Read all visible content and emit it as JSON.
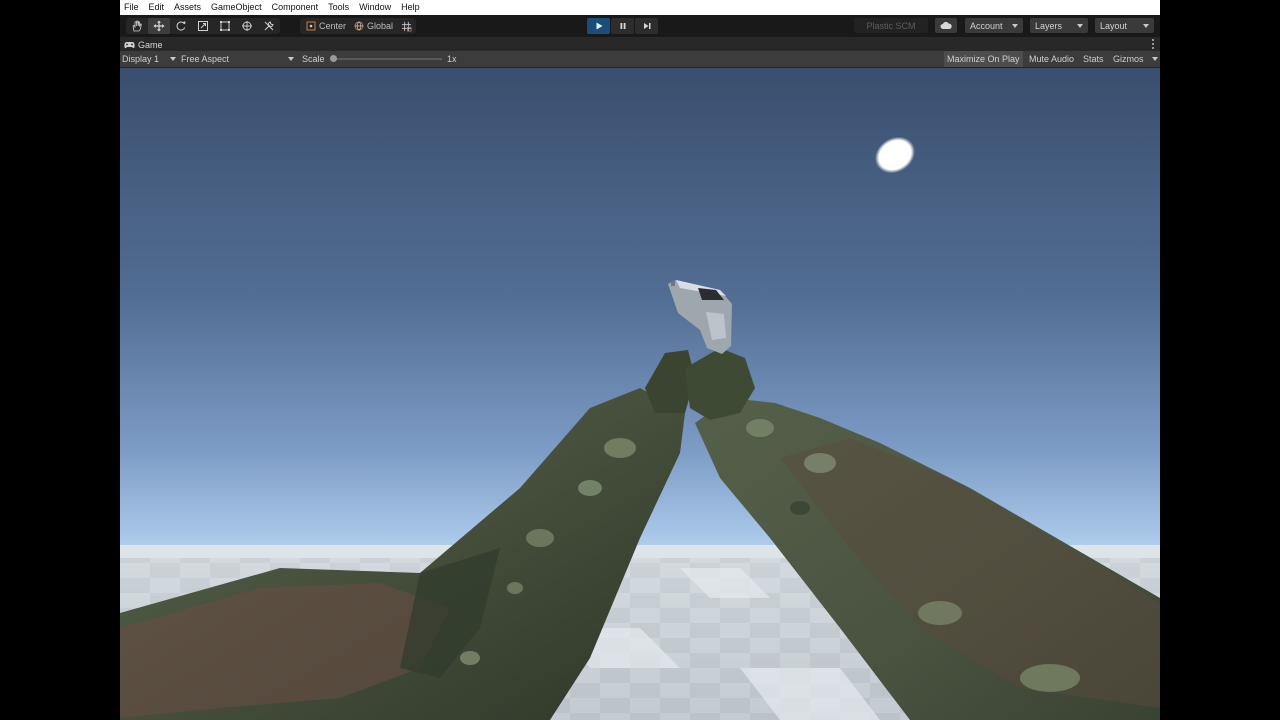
{
  "menu": [
    "File",
    "Edit",
    "Assets",
    "GameObject",
    "Component",
    "Tools",
    "Window",
    "Help"
  ],
  "toolbar": {
    "tools": [
      "hand-tool",
      "move-tool",
      "rotate-tool",
      "scale-tool",
      "rect-tool",
      "transform-tool",
      "custom-tool"
    ],
    "active_tool": "move-tool",
    "pivot_label": "Center",
    "space_label": "Global",
    "play_state": "playing",
    "plastic_label": "Plastic SCM",
    "account_label": "Account",
    "layers_label": "Layers",
    "layout_label": "Layout"
  },
  "game_tab": {
    "label": "Game"
  },
  "game_bar": {
    "display": "Display 1",
    "aspect": "Free Aspect",
    "scale_label": "Scale",
    "scale_value": "1x",
    "maximize": "Maximize On Play",
    "mute": "Mute Audio",
    "stats": "Stats",
    "gizmos": "Gizmos"
  },
  "colors": {
    "play_active": "#1b4d7a",
    "sky_top": "#3a4f6e",
    "sky_horizon": "#e6f2fb",
    "camo_base": "#4e5a43",
    "ground": "#c9d0d5"
  }
}
